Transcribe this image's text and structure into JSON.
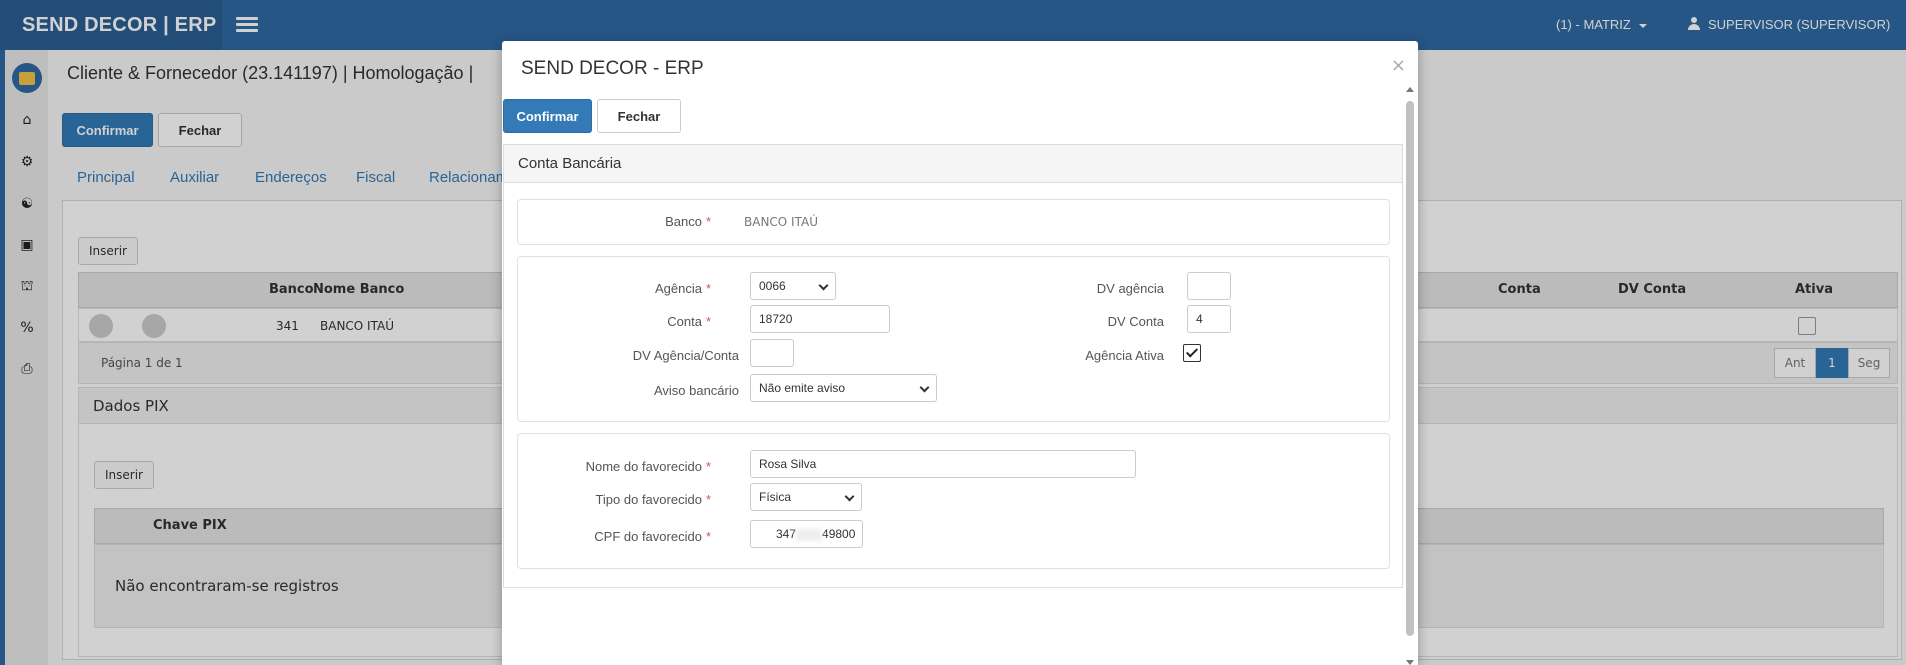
{
  "app": {
    "brand": "SEND DECOR | ERP",
    "branch": "(1) - MATRIZ",
    "user": "SUPERVISOR (SUPERVISOR)"
  },
  "sidebar": {
    "icons": [
      "home-icon",
      "gears-icon",
      "handshake-icon",
      "cubes-icon",
      "bank-icon",
      "percent-icon",
      "print-icon"
    ]
  },
  "page": {
    "title": "Cliente & Fornecedor (23.141197) | Homologação |",
    "confirm_label": "Confirmar",
    "close_label": "Fechar",
    "tabs": [
      "Principal",
      "Auxiliar",
      "Endereços",
      "Fiscal",
      "Relacionam"
    ],
    "bank_grid": {
      "insert_label": "Inserir",
      "headers": {
        "banco": "Banco",
        "nome_banco": "Nome Banco",
        "conta": "Conta",
        "dv_conta": "DV Conta",
        "ativa": "Ativa"
      },
      "rows": [
        {
          "banco": "341",
          "nome_banco": "BANCO ITAÚ",
          "ativa": false
        }
      ],
      "page_info": "Página 1 de 1",
      "pager": {
        "prev": "Ant",
        "current": "1",
        "next": "Seg"
      }
    },
    "pix": {
      "title": "Dados PIX",
      "insert_label": "Inserir",
      "header_key": "Chave PIX",
      "empty_text": "Não encontraram-se registros"
    }
  },
  "modal": {
    "title": "SEND DECOR - ERP",
    "close_symbol": "×",
    "confirm_label": "Confirmar",
    "close_label": "Fechar",
    "section_title": "Conta Bancária",
    "banco": {
      "label": "Banco",
      "value": "BANCO ITAÚ"
    },
    "agencia": {
      "label": "Agência",
      "value": "0066"
    },
    "dv_agencia": {
      "label": "DV agência",
      "value": ""
    },
    "conta": {
      "label": "Conta",
      "value": "18720"
    },
    "dv_conta": {
      "label": "DV Conta",
      "value": "4"
    },
    "dv_agencia_conta": {
      "label": "DV Agência/Conta",
      "value": ""
    },
    "agencia_ativa": {
      "label": "Agência Ativa",
      "checked": true
    },
    "aviso_bancario": {
      "label": "Aviso bancário",
      "value": "Não emite aviso"
    },
    "nome_favorecido": {
      "label": "Nome do favorecido",
      "value": "Rosa Silva"
    },
    "tipo_favorecido": {
      "label": "Tipo do favorecido",
      "value": "Física"
    },
    "cpf_favorecido": {
      "label": "CPF do favorecido",
      "value_start": "347",
      "value_end": "49800"
    },
    "required_marker": "*"
  },
  "colors": {
    "primary": "#337ab7",
    "topbar": "#2f6aa3",
    "required": "#d9534f"
  }
}
